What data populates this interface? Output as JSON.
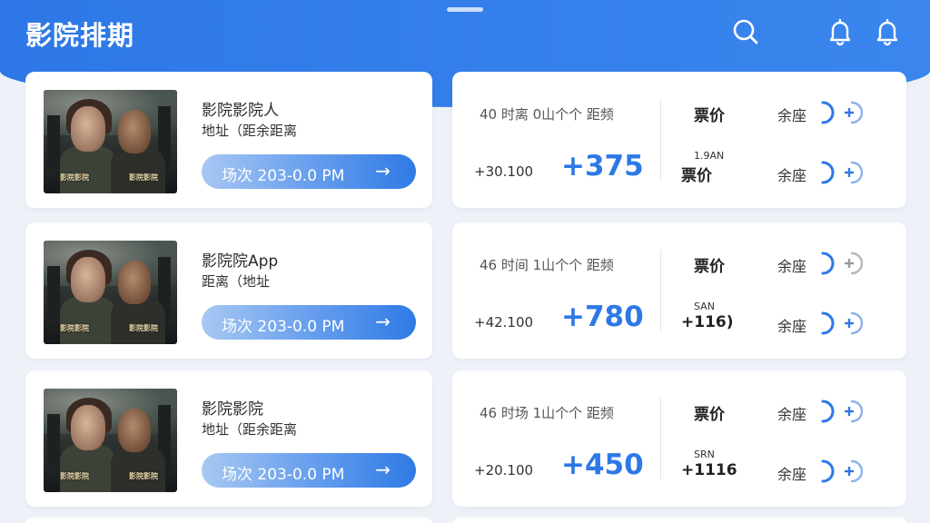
{
  "header": {
    "title": "影院排期",
    "icons": [
      "search-icon",
      "bell-icon",
      "bell-icon"
    ],
    "accent": "#2d78e6"
  },
  "cinemas": [
    {
      "name": "影院影院人",
      "sub": "地址（距余距离",
      "session_label": "场次 203-0.0 PM",
      "session_arrow": "→",
      "poster_caption_left": "影院影院",
      "poster_caption_right": "影院影院",
      "head_left": "40 时离  0山个个  距频",
      "small_left": "+30.100",
      "big_value": "+375",
      "price_label": "票价",
      "tiny_label": "1.9AN",
      "price_label_2": "票价",
      "seat_label_top": "余座",
      "seat_label_bottom": "余座"
    },
    {
      "name": "影院院App",
      "sub": "距离（地址",
      "session_label": "场次 203-0.0 PM",
      "session_arrow": "→",
      "poster_caption_left": "影院影院",
      "poster_caption_right": "影院影院",
      "head_left": "46 时间  1山个个  距频",
      "small_left": "+42.100",
      "big_value": "+780",
      "price_label": "票价",
      "tiny_label": "SAN",
      "price_label_2": "+116)",
      "seat_label_top": "余座",
      "seat_label_bottom": "余座"
    },
    {
      "name": "影院影院",
      "sub": "地址（距余距离",
      "session_label": "场次 203-0.0 PM",
      "session_arrow": "→",
      "poster_caption_left": "影院影院",
      "poster_caption_right": "影院影院",
      "head_left": "46 时场  1山个个  距频",
      "small_left": "+20.100",
      "big_value": "+450",
      "price_label": "票价",
      "tiny_label": "SRN",
      "price_label_2": "+1116",
      "seat_label_top": "余座",
      "seat_label_bottom": "余座"
    }
  ]
}
